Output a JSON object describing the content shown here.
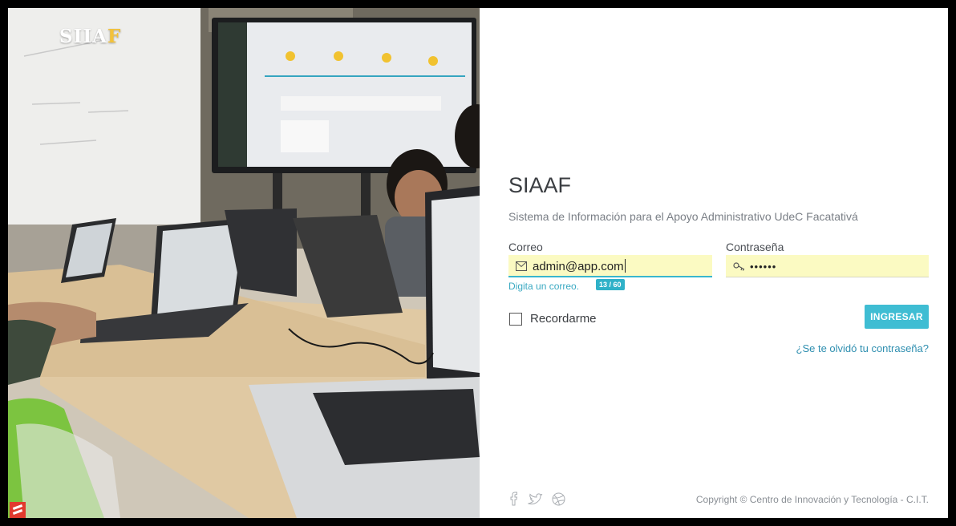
{
  "brand": {
    "text_main": "SIIA",
    "text_accent": "F"
  },
  "login": {
    "title": "SIAAF",
    "subtitle": "Sistema de Información para el Apoyo Administrativo UdeC Facatativá",
    "email": {
      "label": "Correo",
      "value": "admin@app.com",
      "icon": "envelope-icon",
      "hint": "Digita un correo.",
      "counter": "13 / 60"
    },
    "password": {
      "label": "Contraseña",
      "value": "••••••",
      "icon": "key-icon"
    },
    "remember_label": "Recordarme",
    "remember_checked": false,
    "submit_label": "INGRESAR",
    "forgot_label": "¿Se te olvidó tu contraseña?"
  },
  "footer": {
    "social_icons": [
      "facebook-icon",
      "twitter-icon",
      "dribbble-icon"
    ],
    "copyright": "Copyright © Centro de Innovación y Tecnología - C.I.T."
  },
  "colors": {
    "accent": "#3fbdd3",
    "field_bg": "#fbfac2",
    "brand_accent": "#f3c23a",
    "link": "#2f8fb0"
  }
}
